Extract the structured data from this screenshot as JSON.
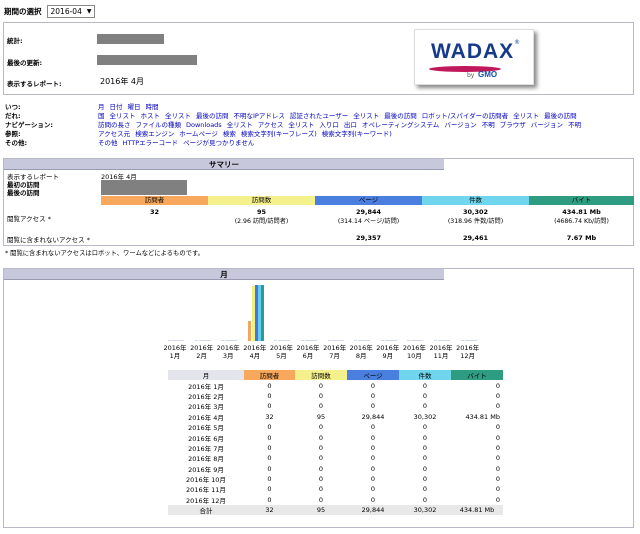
{
  "period": {
    "label": "期間の選択",
    "selected": "2016-04"
  },
  "info": {
    "stats_label": "統計:",
    "updated_label": "最後の更新:",
    "report_label": "表示するレポート:",
    "report_value": "2016年 4月"
  },
  "logo": {
    "name": "WADAX",
    "by": "by",
    "company": "GMO"
  },
  "nav": [
    {
      "key": "いつ:",
      "items": [
        "月",
        "日付",
        "曜日",
        "時間"
      ]
    },
    {
      "key": "だれ:",
      "items": [
        "国",
        "全リスト",
        "ホスト",
        "全リスト",
        "最後の訪問",
        "不明なIPアドレス",
        "認証されたユーザー",
        "全リスト",
        "最後の訪問",
        "ロボット/スパイダーの訪問者",
        "全リスト",
        "最後の訪問"
      ]
    },
    {
      "key": "ナビゲーション:",
      "items": [
        "訪問の長さ",
        "ファイルの種類",
        "Downloads",
        "全リスト",
        "アクセス",
        "全リスト",
        "入り口",
        "出口",
        "オペレーティングシステム",
        "バージョン",
        "不明",
        "ブラウザ",
        "バージョン",
        "不明"
      ]
    },
    {
      "key": "参照:",
      "items": [
        "アクセス元",
        "検索エンジン",
        "ホームページ",
        "検索",
        "検索文字列(キーフレーズ)",
        "検索文字列(キーワード)"
      ]
    },
    {
      "key": "その他:",
      "items": [
        "その他",
        "HTTPエラーコード",
        "ページが見つかりません"
      ]
    }
  ],
  "summary": {
    "title": "サマリー",
    "report_label": "表示するレポート",
    "report_value": "2016年 4月",
    "first_visit_label": "最初の訪問",
    "last_visit_label": "最後の訪問",
    "headers": [
      "訪問者",
      "訪問数",
      "ページ",
      "件数",
      "バイト"
    ],
    "traffic_label": "閲覧アクセス *",
    "traffic": [
      "32",
      "95",
      "29,844",
      "30,302",
      "434.81 Mb"
    ],
    "traffic_sub": [
      "",
      "(2.96 訪問/訪問者)",
      "(314.14 ページ/訪問)",
      "(318.96 件数/訪問)",
      "(4686.74 Kb/訪問)"
    ],
    "nontraffic_label": "閲覧に含まれないアクセス *",
    "nontraffic": [
      "",
      "",
      "29,357",
      "29,461",
      "7.67 Mb"
    ],
    "footnote": "* 閲覧に含まれないアクセスはロボット、ワームなどによるものです。"
  },
  "monthly": {
    "title": "月",
    "col_month": "月",
    "headers": [
      "訪問者",
      "訪問数",
      "ページ",
      "件数",
      "バイト"
    ],
    "rows": [
      {
        "month": "2016年 1月",
        "v": [
          "0",
          "0",
          "0",
          "0",
          "0"
        ]
      },
      {
        "month": "2016年 2月",
        "v": [
          "0",
          "0",
          "0",
          "0",
          "0"
        ]
      },
      {
        "month": "2016年 3月",
        "v": [
          "0",
          "0",
          "0",
          "0",
          "0"
        ]
      },
      {
        "month": "2016年 4月",
        "v": [
          "32",
          "95",
          "29,844",
          "30,302",
          "434.81 Mb"
        ]
      },
      {
        "month": "2016年 5月",
        "v": [
          "0",
          "0",
          "0",
          "0",
          "0"
        ]
      },
      {
        "month": "2016年 6月",
        "v": [
          "0",
          "0",
          "0",
          "0",
          "0"
        ]
      },
      {
        "month": "2016年 7月",
        "v": [
          "0",
          "0",
          "0",
          "0",
          "0"
        ]
      },
      {
        "month": "2016年 8月",
        "v": [
          "0",
          "0",
          "0",
          "0",
          "0"
        ]
      },
      {
        "month": "2016年 9月",
        "v": [
          "0",
          "0",
          "0",
          "0",
          "0"
        ]
      },
      {
        "month": "2016年 10月",
        "v": [
          "0",
          "0",
          "0",
          "0",
          "0"
        ]
      },
      {
        "month": "2016年 11月",
        "v": [
          "0",
          "0",
          "0",
          "0",
          "0"
        ]
      },
      {
        "month": "2016年 12月",
        "v": [
          "0",
          "0",
          "0",
          "0",
          "0"
        ]
      }
    ],
    "total_label": "合計",
    "totals": [
      "32",
      "95",
      "29,844",
      "30,302",
      "434.81 Mb"
    ]
  },
  "chart_data": {
    "type": "bar",
    "categories": [
      "2016年 1月",
      "2016年 2月",
      "2016年 3月",
      "2016年 4月",
      "2016年 5月",
      "2016年 6月",
      "2016年 7月",
      "2016年 8月",
      "2016年 9月",
      "2016年 10月",
      "2016年 11月",
      "2016年 12月"
    ],
    "category_lines": [
      [
        "2016年",
        "1月"
      ],
      [
        "2016年",
        "2月"
      ],
      [
        "2016年",
        "3月"
      ],
      [
        "2016年",
        "4月"
      ],
      [
        "2016年",
        "5月"
      ],
      [
        "2016年",
        "6月"
      ],
      [
        "2016年",
        "7月"
      ],
      [
        "2016年",
        "8月"
      ],
      [
        "2016年",
        "9月"
      ],
      [
        "2016年",
        "10月"
      ],
      [
        "2016年",
        "11月"
      ],
      [
        "2016年",
        "12月"
      ]
    ],
    "series": [
      {
        "values": [
          0,
          0,
          0,
          32,
          0,
          0,
          0,
          0,
          0,
          0,
          0,
          0
        ]
      },
      {
        "values": [
          0,
          0,
          0,
          95,
          0,
          0,
          0,
          0,
          0,
          0,
          0,
          0
        ]
      },
      {
        "values": [
          0,
          0,
          0,
          29844,
          0,
          0,
          0,
          0,
          0,
          0,
          0,
          0
        ]
      },
      {
        "values": [
          0,
          0,
          0,
          30302,
          0,
          0,
          0,
          0,
          0,
          0,
          0,
          0
        ]
      },
      {
        "values": [
          0,
          0,
          0,
          434.81,
          0,
          0,
          0,
          0,
          0,
          0,
          0,
          0
        ]
      }
    ],
    "colors": [
      "#f4a460",
      "#f0f080",
      "#4477dd",
      "#66ccee",
      "#2a9d8f"
    ]
  },
  "colors": {
    "visitors": "#f8a85c",
    "visits": "#f4f08c",
    "pages": "#4a7fe0",
    "hits": "#6fd6ee",
    "bytes": "#2e9c80",
    "section_header": "#c8c8dc"
  }
}
